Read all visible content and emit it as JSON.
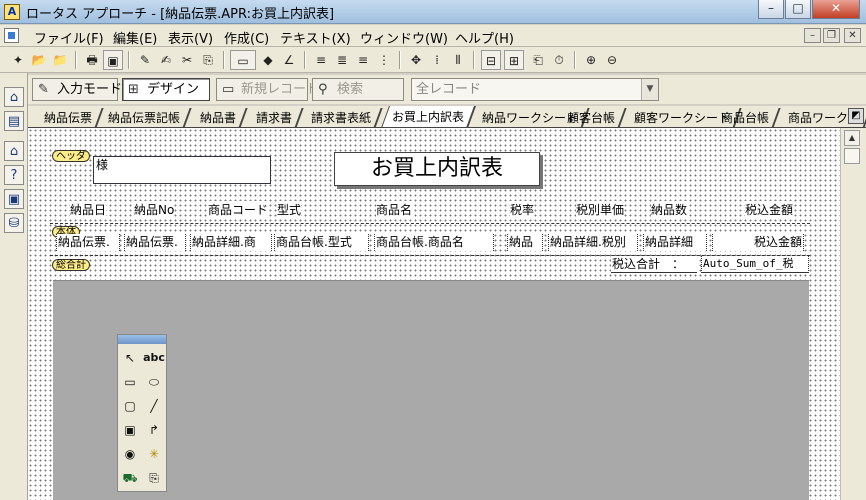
{
  "window": {
    "title": "ロータス アプローチ - [納品伝票.APR:お買上内訳表]",
    "minimize": "–",
    "maximize": "□",
    "close": "✕"
  },
  "menu": {
    "items": [
      "ファイル(F)",
      "編集(E)",
      "表示(V)",
      "作成(C)",
      "テキスト(X)",
      "ウィンドウ(W)",
      "ヘルプ(H)"
    ],
    "mdi": [
      "–",
      "❐",
      "✕"
    ]
  },
  "toolbar1": {
    "icons": [
      "new-icon",
      "open-icon",
      "save-icon",
      "print-icon",
      "print-preview-icon",
      "pen-icon",
      "signature-icon",
      "cut-icon",
      "copy-icon",
      "paste-icon",
      "field-icon",
      "shapes-icon",
      "brush-icon",
      "align-left-icon",
      "align-center-icon",
      "align-right-icon",
      "grid-icon",
      "move-icon",
      "columns-icon",
      "report-icon",
      "envelope-icon",
      "macro-icon",
      "table-icon",
      "timer-icon",
      "zoom-in-icon",
      "zoom-out-icon"
    ]
  },
  "sidebar": {
    "icons": [
      "home-icon",
      "help-icon",
      "folder-icon",
      "search-icon",
      "filter-icon",
      "design-icon"
    ]
  },
  "toolbar2": {
    "input_mode": "入力モード",
    "design": "デザイン",
    "new_record": "新規レコード",
    "search": "検索",
    "view_select": "全レコード"
  },
  "tabs": [
    "納品伝票",
    "納品伝票記帳",
    "納品書",
    "請求書",
    "請求書表紙",
    "お買上内訳表",
    "納品ワークシート",
    "顧客台帳",
    "顧客ワークシート",
    "商品台帳",
    "商品ワークシ"
  ],
  "active_tab": "お買上内訳表",
  "report": {
    "header_label": "ヘッダ",
    "sama": "様",
    "title": "お買上内訳表",
    "columns": [
      "納品日",
      "納品No",
      "商品コード",
      "型式",
      "商品名",
      "税率",
      "税別単価",
      "納品数",
      "税込金額"
    ],
    "body_label": "本体",
    "body_fields": [
      "納品伝票.",
      "納品伝票.",
      "納品詳細.商",
      "商品台帳.型式",
      "商品台帳.商品名",
      "納品",
      "納品詳細.税別",
      "納品詳細",
      "税込金額"
    ],
    "total_label": "総合計",
    "total_caption": "税込合計　：",
    "total_field": "Auto_Sum_of_税"
  },
  "toolbox": {
    "tools": [
      "↖",
      "abc",
      "▭",
      "⬭",
      "▢",
      "╱",
      "▣",
      "↱",
      "◉",
      "✳",
      "⛟",
      "⎘"
    ]
  }
}
